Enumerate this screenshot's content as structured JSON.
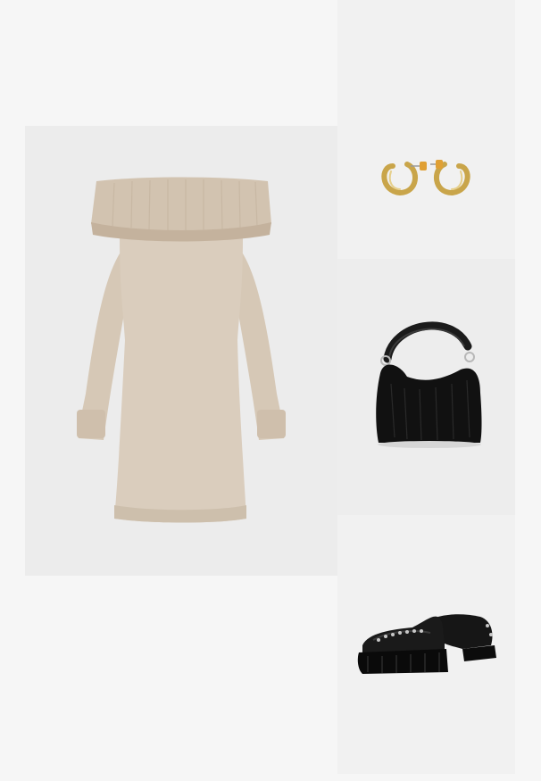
{
  "outfit": {
    "items": [
      {
        "icon": "dress-icon"
      },
      {
        "icon": "earrings-icon"
      },
      {
        "icon": "handbag-icon"
      },
      {
        "icon": "loafer-shoe-icon"
      }
    ]
  },
  "colors": {
    "background": "#f6f6f6",
    "tile": "#ededed",
    "knit_beige": "#d9cbbb",
    "knit_shadow": "#c7b6a2",
    "gold": "#c9a54a",
    "black": "#141414"
  }
}
